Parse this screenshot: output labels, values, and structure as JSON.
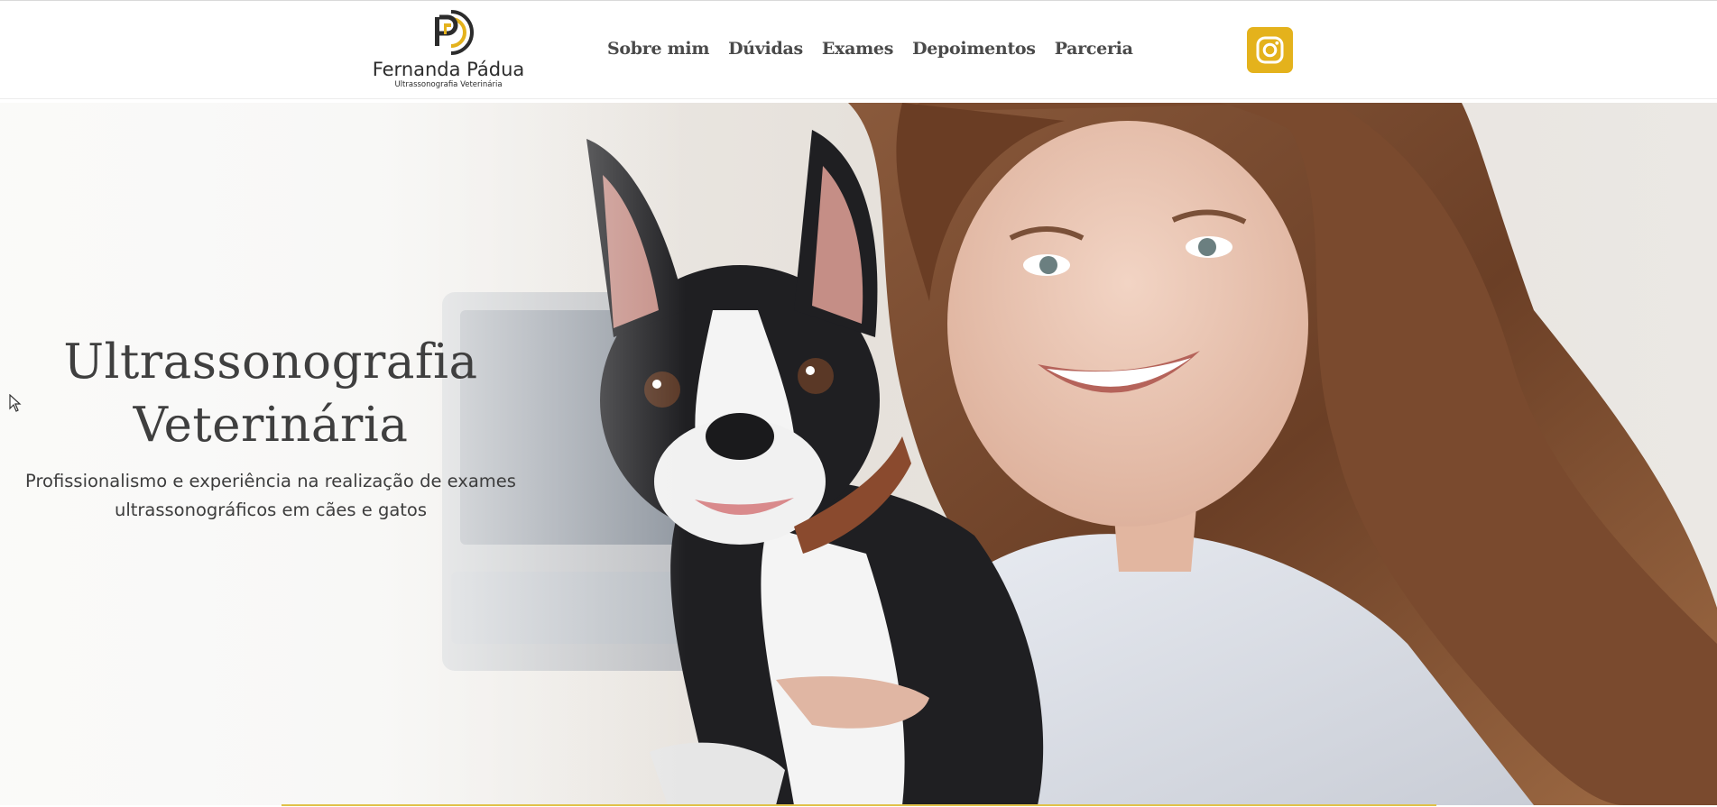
{
  "header": {
    "logo": {
      "mark_letters": "FP",
      "name": "Fernanda Pádua",
      "subtitle": "Ultrassonografia Veterinária"
    },
    "nav": [
      {
        "label": "Sobre mim"
      },
      {
        "label": "Dúvidas"
      },
      {
        "label": "Exames"
      },
      {
        "label": "Depoimentos"
      },
      {
        "label": "Parceria"
      }
    ],
    "social": {
      "icon": "instagram-icon",
      "color": "#e4b21c"
    }
  },
  "hero": {
    "title_line1": "Ultrassonografia",
    "title_line2": "Veterinária",
    "subtitle_line1": "Profissionalismo e experiência na realização de exames",
    "subtitle_line2": "ultrassonográficos em cães e gatos",
    "image": "photo of a smiling veterinarian holding a black and white Boston terrier"
  },
  "colors": {
    "accent": "#e4b21c",
    "text_dark": "#3f3f3f",
    "nav_text": "#4a4a4a"
  }
}
